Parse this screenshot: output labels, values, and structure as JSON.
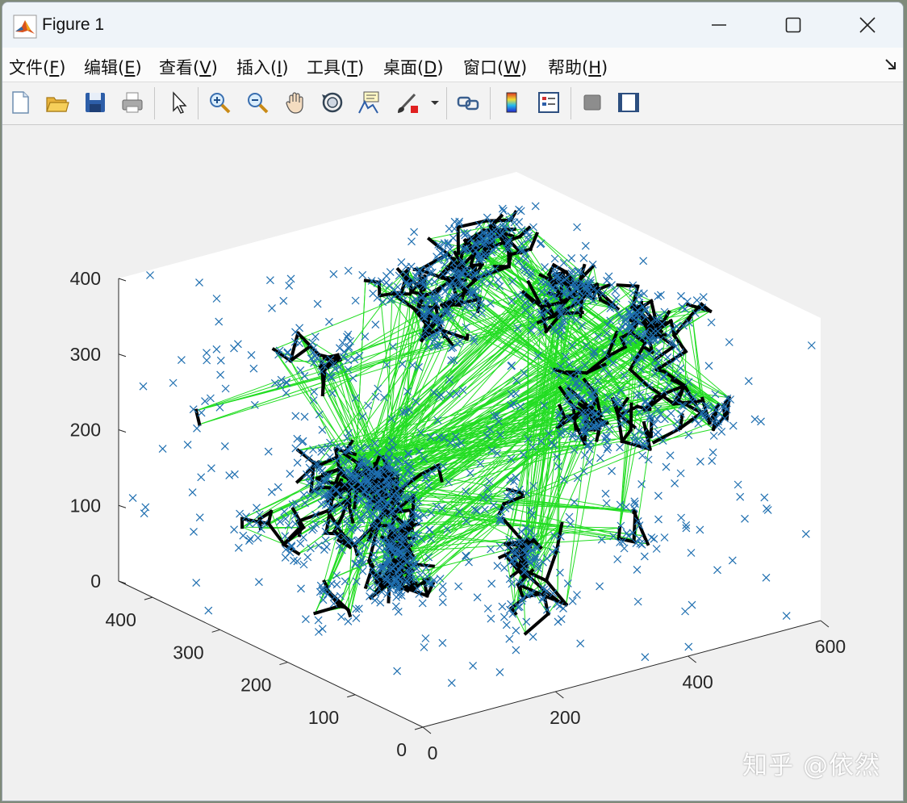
{
  "window": {
    "title": "Figure 1"
  },
  "menu": [
    {
      "label": "文件(",
      "key": "F",
      "suffix": ")"
    },
    {
      "label": "编辑(",
      "key": "E",
      "suffix": ")"
    },
    {
      "label": "查看(",
      "key": "V",
      "suffix": ")"
    },
    {
      "label": "插入(",
      "key": "I",
      "suffix": ")"
    },
    {
      "label": "工具(",
      "key": "T",
      "suffix": ")"
    },
    {
      "label": "桌面(",
      "key": "D",
      "suffix": ")"
    },
    {
      "label": "窗口(",
      "key": "W",
      "suffix": ")"
    },
    {
      "label": "帮助(",
      "key": "H",
      "suffix": ")"
    }
  ],
  "toolbar_icons": [
    "new-file-icon",
    "open-folder-icon",
    "save-icon",
    "print-icon",
    "select-arrow-icon",
    "zoom-in-icon",
    "zoom-out-icon",
    "pan-hand-icon",
    "rotate-3d-icon",
    "data-cursor-icon",
    "brush-icon",
    "brush-dropdown-icon",
    "link-plot-icon",
    "colorbar-icon",
    "legend-icon",
    "hide-plot-tools-icon",
    "show-plot-tools-icon"
  ],
  "watermark": "知乎 @依然",
  "colors": {
    "markers": "#1f6fb0",
    "graph_edges": "#22dd22",
    "tree_edges": "#000000",
    "axis": "#262626"
  },
  "chart_data": {
    "type": "scatter",
    "projection": "3d",
    "markers": "x",
    "x_ticks": [
      "0",
      "200",
      "400",
      "600"
    ],
    "y_ticks": [
      "0",
      "100",
      "200",
      "300",
      "400"
    ],
    "z_ticks": [
      "0",
      "100",
      "200",
      "300",
      "400"
    ],
    "xlim": [
      0,
      600
    ],
    "ylim": [
      0,
      450
    ],
    "zlim": [
      0,
      400
    ],
    "series": [
      {
        "style": "blue x markers",
        "approx_count": 1500
      },
      {
        "style": "green thin lines",
        "approx_count": 1200
      },
      {
        "style": "black thick branching lines",
        "approx_count": 600
      }
    ]
  }
}
